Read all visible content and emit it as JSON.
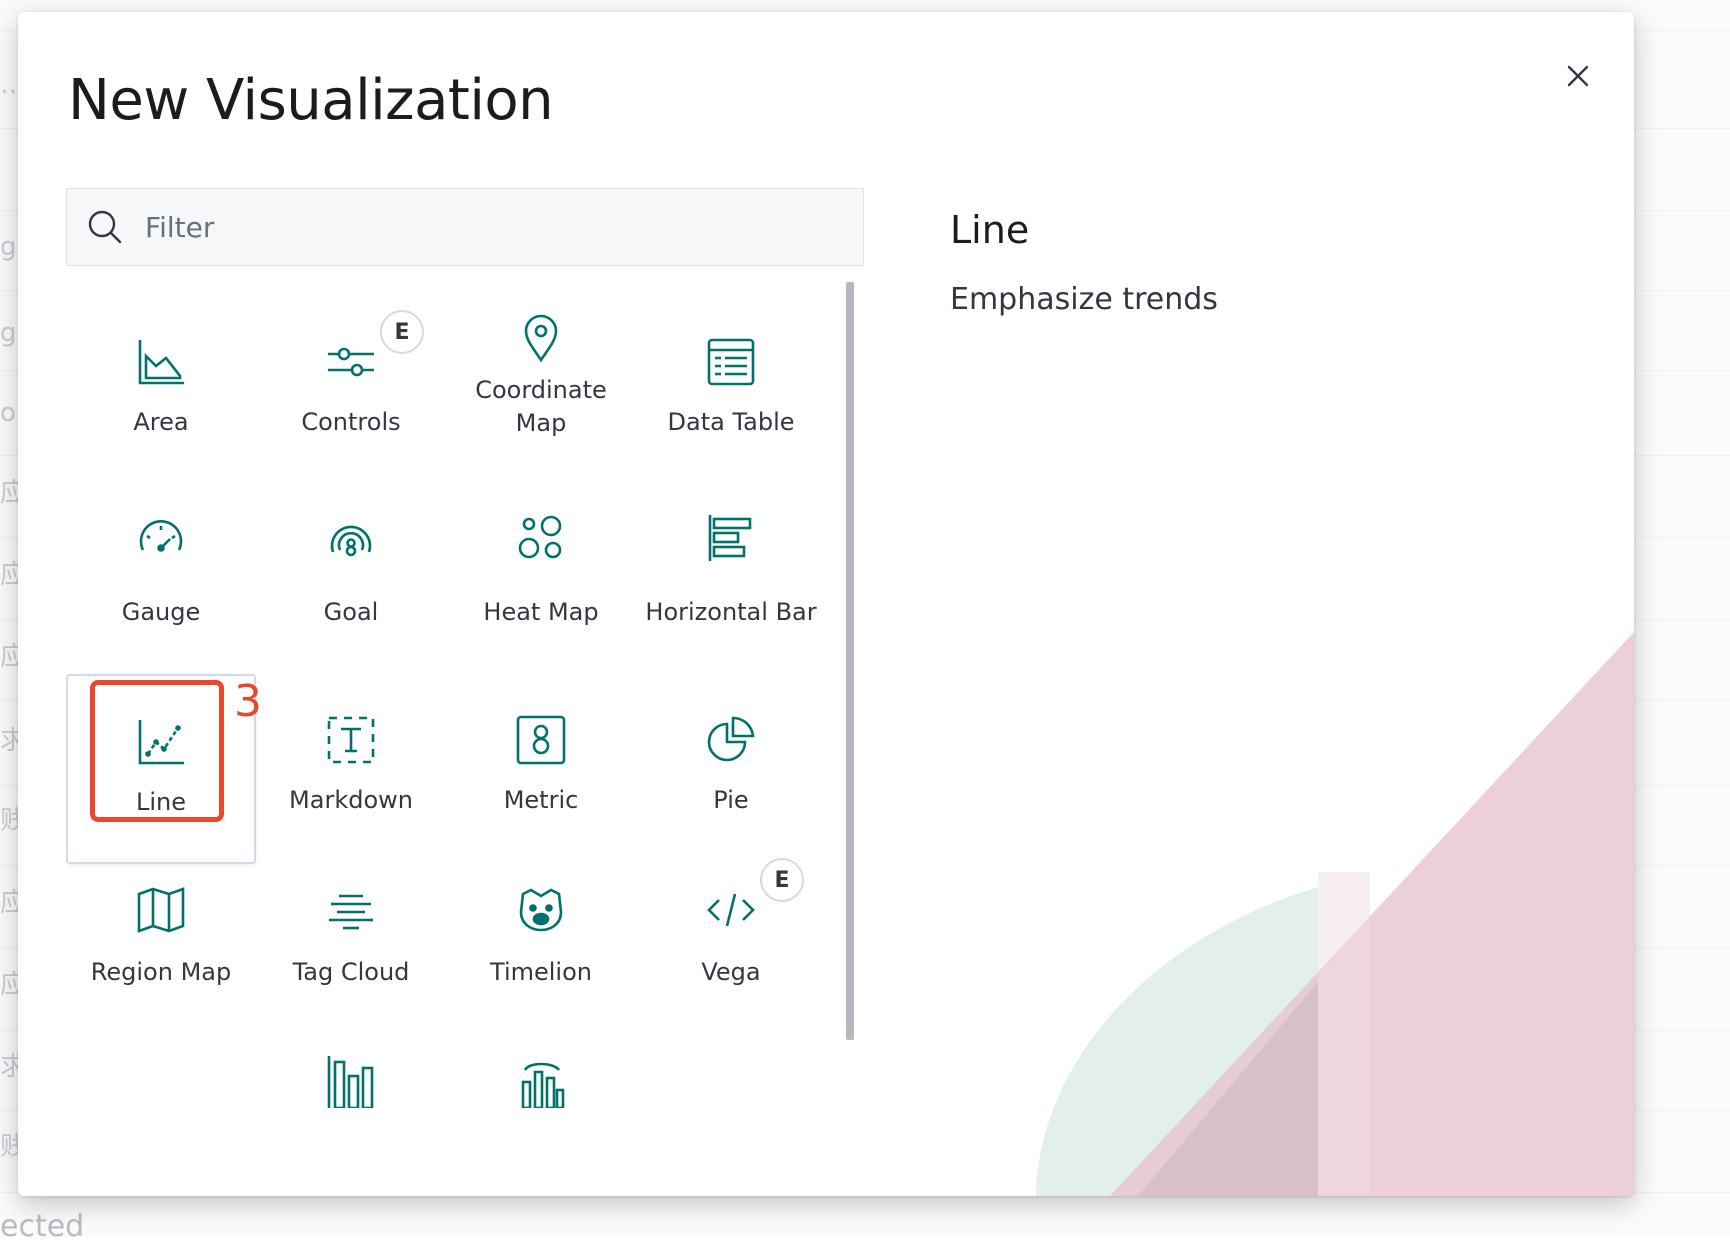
{
  "modal": {
    "title": "New Visualization",
    "close_label": "close"
  },
  "search": {
    "placeholder": "Filter",
    "value": ""
  },
  "visualizations": [
    {
      "id": "area",
      "label": "Area",
      "icon": "area-chart-icon"
    },
    {
      "id": "controls",
      "label": "Controls",
      "icon": "controls-icon",
      "badge": "E"
    },
    {
      "id": "coordinate-map",
      "label": "Coordinate Map",
      "icon": "map-pin-icon"
    },
    {
      "id": "data-table",
      "label": "Data Table",
      "icon": "table-icon"
    },
    {
      "id": "gauge",
      "label": "Gauge",
      "icon": "gauge-icon"
    },
    {
      "id": "goal",
      "label": "Goal",
      "icon": "goal-icon"
    },
    {
      "id": "heat-map",
      "label": "Heat Map",
      "icon": "heat-map-icon"
    },
    {
      "id": "horizontal-bar",
      "label": "Horizontal Bar",
      "icon": "horizontal-bar-icon"
    },
    {
      "id": "line",
      "label": "Line",
      "icon": "line-chart-icon",
      "selected": true
    },
    {
      "id": "markdown",
      "label": "Markdown",
      "icon": "markdown-icon"
    },
    {
      "id": "metric",
      "label": "Metric",
      "icon": "metric-icon"
    },
    {
      "id": "pie",
      "label": "Pie",
      "icon": "pie-chart-icon"
    },
    {
      "id": "region-map",
      "label": "Region Map",
      "icon": "region-map-icon"
    },
    {
      "id": "tag-cloud",
      "label": "Tag Cloud",
      "icon": "tag-cloud-icon"
    },
    {
      "id": "timelion",
      "label": "Timelion",
      "icon": "timelion-icon"
    },
    {
      "id": "vega",
      "label": "Vega",
      "icon": "vega-code-icon",
      "badge": "E"
    },
    {
      "id": "partial-1",
      "label": "",
      "icon": "vertical-bar-icon"
    },
    {
      "id": "partial-2",
      "label": "",
      "icon": "visual-builder-icon"
    }
  ],
  "annotation": {
    "step": "3"
  },
  "description": {
    "title": "Line",
    "text": "Emphasize trends"
  },
  "background": {
    "left_glyphs": [
      "…",
      "gl",
      "g",
      "o",
      "应",
      "应",
      "应",
      "求",
      "贱",
      "应",
      "应",
      "求",
      "贱"
    ],
    "bottom_text": "ected"
  },
  "colors": {
    "icon": "#00726b",
    "highlight": "#e8492b",
    "text": "#343741"
  }
}
